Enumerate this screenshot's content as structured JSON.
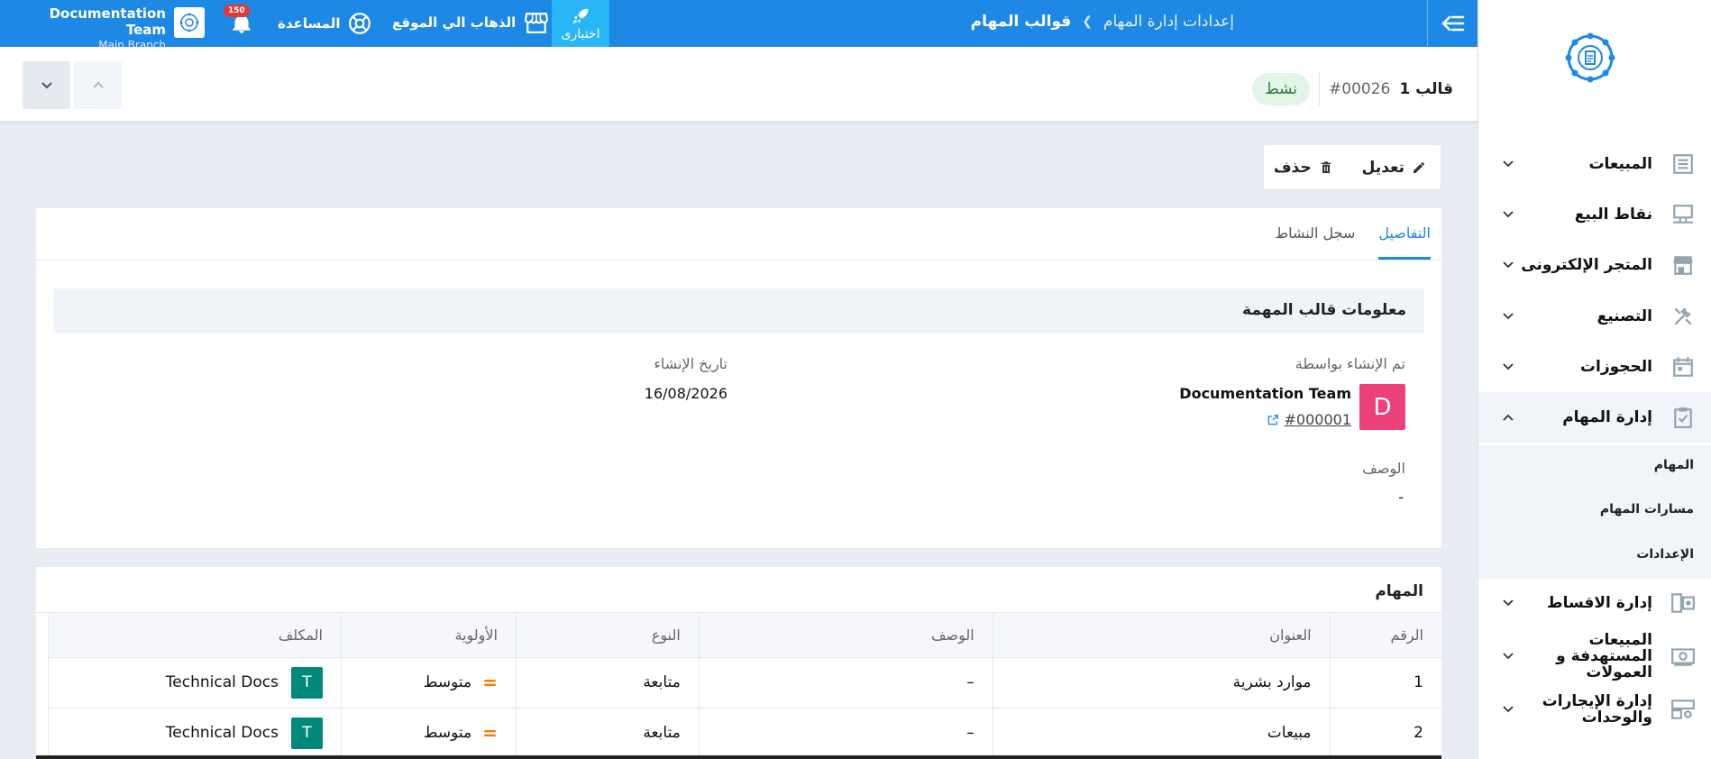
{
  "topbar": {
    "user_name": "Documentation Team",
    "branch": "Main Branch",
    "notif_count": "150",
    "help_label": "المساعدة",
    "site_label": "الذهاب الي الموقع",
    "trial_label": "اختبارى",
    "breadcrumb_parent": "إعدادات إدارة المهام",
    "breadcrumb_current": "قوالب المهام",
    "accent": "#1e88e5"
  },
  "header": {
    "title": "قالب 1",
    "number": "#00026",
    "status": "نشط"
  },
  "actions": {
    "edit_label": "تعديل",
    "delete_label": "حذف"
  },
  "tabs": {
    "details": "التفاصيل",
    "activity": "سجل النشاط"
  },
  "info": {
    "section_title": "معلومات قالب المهمة",
    "created_by_label": "تم الإنشاء بواسطة",
    "creator_name": "Documentation Team",
    "creator_initial": "D",
    "creator_id": "#000001",
    "created_date_label": "تاريخ الإنشاء",
    "created_date": "16/08/2026",
    "description_label": "الوصف",
    "description": "-"
  },
  "tasks": {
    "title": "المهام",
    "columns": [
      "الرقم",
      "العنوان",
      "الوصف",
      "النوع",
      "الأولوية",
      "المكلف"
    ],
    "rows": [
      {
        "num": "1",
        "title": "موارد بشرية",
        "desc": "–",
        "type": "متابعة",
        "priority": "متوسط",
        "assignee": "Technical Docs",
        "initial": "T"
      },
      {
        "num": "2",
        "title": "مبيعات",
        "desc": "–",
        "type": "متابعة",
        "priority": "متوسط",
        "assignee": "Technical Docs",
        "initial": "T"
      }
    ]
  },
  "sidebar": {
    "items": [
      {
        "label": "المبيعات",
        "icon": "receipt-icon"
      },
      {
        "label": "نقاط البيع",
        "icon": "pos-terminal-icon"
      },
      {
        "label": "المتجر الإلكترونى",
        "icon": "store-icon"
      },
      {
        "label": "التصنيع",
        "icon": "tools-icon"
      },
      {
        "label": "الحجوزات",
        "icon": "calendar-icon"
      },
      {
        "label": "إدارة المهام",
        "icon": "task-check-icon"
      },
      {
        "label": "إدارة الاقساط",
        "icon": "installments-icon"
      },
      {
        "label": "المبيعات المستهدفة و العمولات",
        "icon": "money-icon"
      },
      {
        "label": "إدارة الإيجارات والوحدات",
        "icon": "rental-units-icon"
      }
    ],
    "sub_items": [
      "المهام",
      "مسارات المهام",
      "الإعدادات"
    ]
  }
}
